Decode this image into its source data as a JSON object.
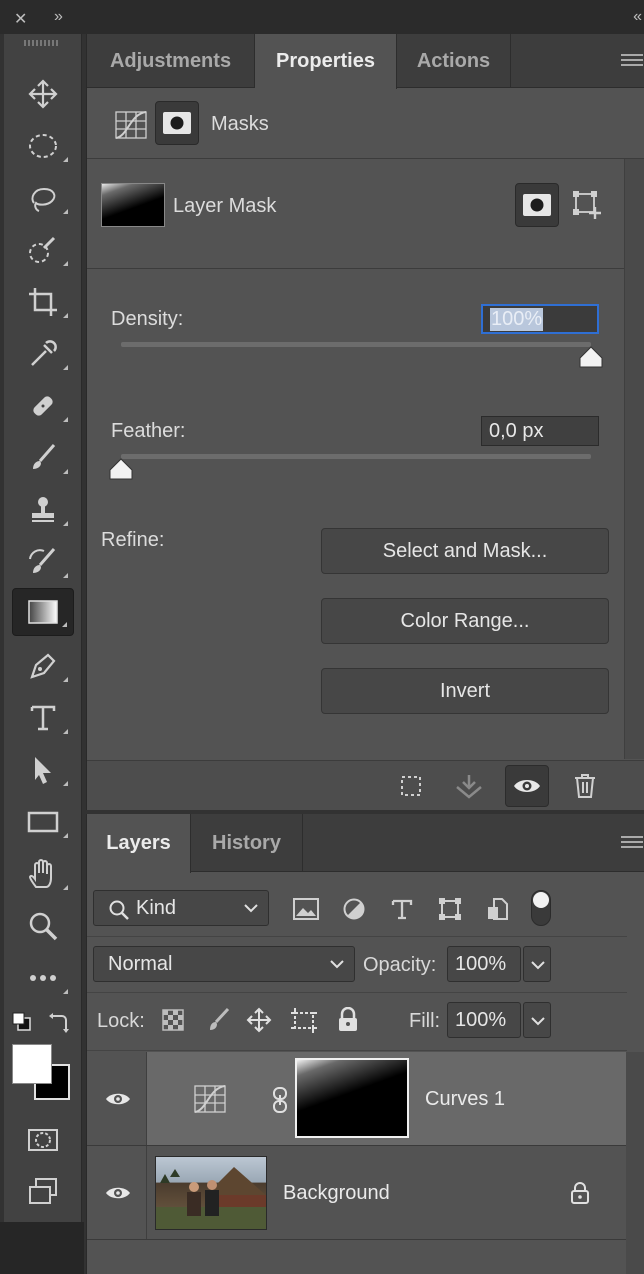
{
  "top_strip": {
    "close": "✕",
    "collapse_left": "»",
    "collapse_right": "«"
  },
  "properties_panel": {
    "tabs": [
      {
        "label": "Adjustments"
      },
      {
        "label": "Properties"
      },
      {
        "label": "Actions"
      }
    ],
    "masks_label": "Masks",
    "layer_mask_label": "Layer Mask",
    "density": {
      "label": "Density:",
      "value": "100%",
      "level_percent": 100
    },
    "feather": {
      "label": "Feather:",
      "value": "0,0 px",
      "level_percent": 0
    },
    "refine_label": "Refine:",
    "buttons": {
      "select_and_mask": "Select and Mask...",
      "color_range": "Color Range...",
      "invert": "Invert"
    }
  },
  "layers_panel": {
    "tabs": [
      {
        "label": "Layers"
      },
      {
        "label": "History"
      }
    ],
    "filter_kind": "Kind",
    "blend_mode": "Normal",
    "opacity_label": "Opacity:",
    "opacity_value": "100%",
    "lock_label": "Lock:",
    "fill_label": "Fill:",
    "fill_value": "100%",
    "layers": [
      {
        "name": "Curves 1",
        "selected": true
      },
      {
        "name": "Background",
        "locked": true
      }
    ]
  },
  "colors": {
    "accent_focus": "#2f6fd4",
    "panel_bg": "#535353",
    "toolbar_bg": "#424242"
  }
}
